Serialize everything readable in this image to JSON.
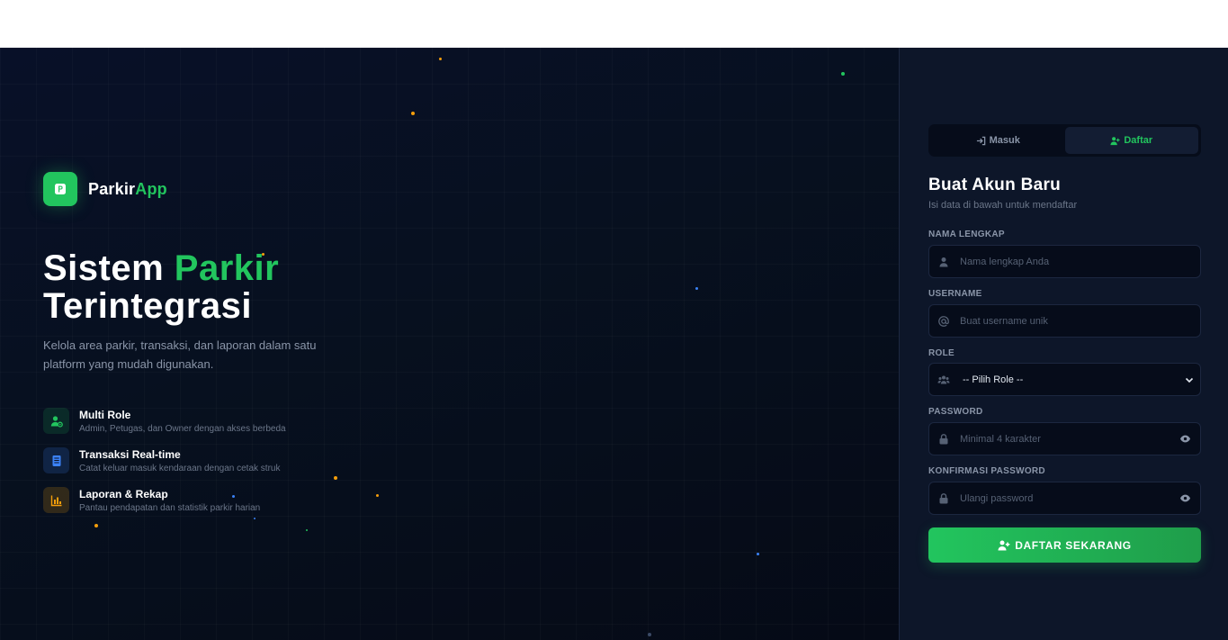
{
  "brand": {
    "name_prefix": "Parkir",
    "name_accent": "App",
    "logo_icon": "parking-p-icon",
    "accent_color": "#22c55e"
  },
  "hero": {
    "headline_line1_prefix": "Sistem ",
    "headline_line1_accent": "Parkir",
    "headline_line2": "Terintegrasi",
    "subtitle": "Kelola area parkir, transaksi, dan laporan dalam satu platform yang mudah digunakan.",
    "features": [
      {
        "icon": "user-gear-icon",
        "title": "Multi Role",
        "description": "Admin, Petugas, dan Owner dengan akses berbeda",
        "color": "#22c55e"
      },
      {
        "icon": "receipt-icon",
        "title": "Transaksi Real-time",
        "description": "Catat keluar masuk kendaraan dengan cetak struk",
        "color": "#3b82f6"
      },
      {
        "icon": "chart-icon",
        "title": "Laporan & Rekap",
        "description": "Pantau pendapatan dan statistik parkir harian",
        "color": "#f59e0b"
      }
    ]
  },
  "auth": {
    "tabs": [
      {
        "label": "Masuk",
        "icon": "login-icon",
        "active": false
      },
      {
        "label": "Daftar",
        "icon": "user-plus-icon",
        "active": true
      }
    ],
    "title": "Buat Akun Baru",
    "subtitle": "Isi data di bawah untuk mendaftar",
    "fields": {
      "fullname": {
        "label": "NAMA LENGKAP",
        "placeholder": "Nama lengkap Anda",
        "icon": "user-icon"
      },
      "username": {
        "label": "USERNAME",
        "placeholder": "Buat username unik",
        "icon": "at-icon"
      },
      "role": {
        "label": "ROLE",
        "selected": "-- Pilih Role --",
        "icon": "users-icon"
      },
      "password": {
        "label": "PASSWORD",
        "placeholder": "Minimal 4 karakter",
        "icon": "lock-icon"
      },
      "confirm": {
        "label": "KONFIRMASI PASSWORD",
        "placeholder": "Ulangi password",
        "icon": "lock-icon"
      }
    },
    "submit_label": "DAFTAR SEKARANG"
  }
}
